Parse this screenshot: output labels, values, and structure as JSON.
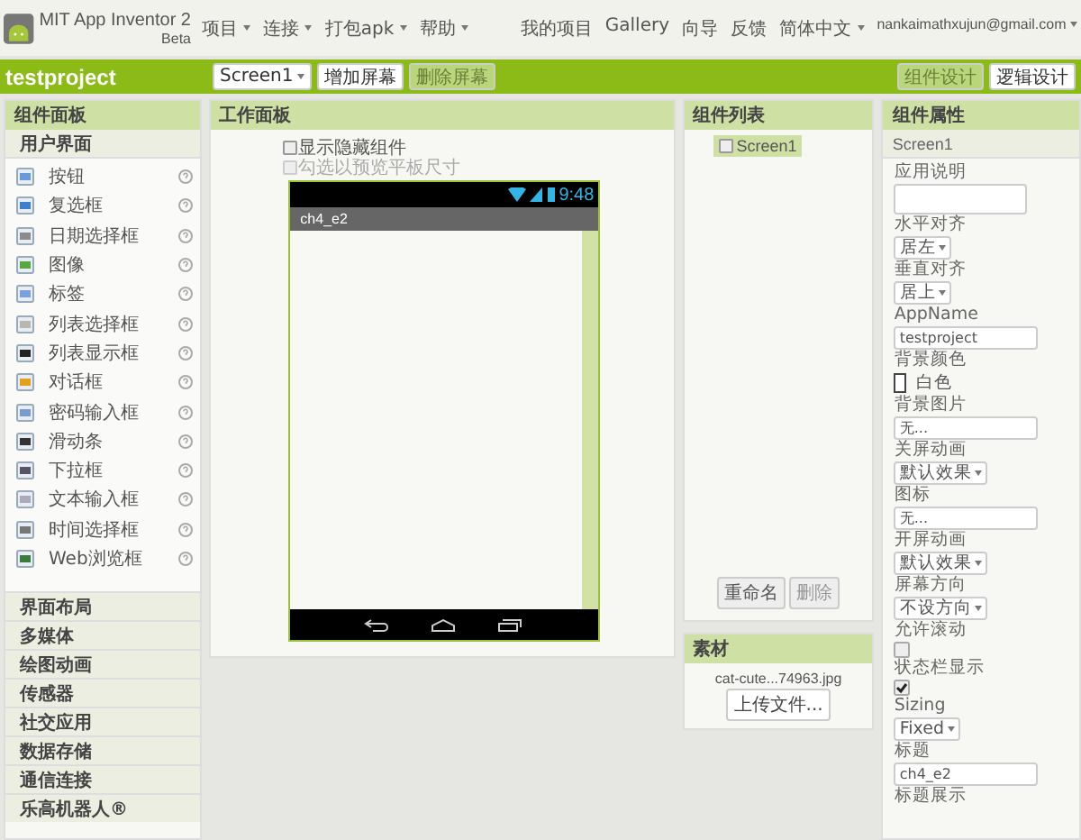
{
  "header": {
    "logo_title": "MIT App Inventor 2",
    "logo_subtitle": "Beta",
    "menus": [
      {
        "label": "项目",
        "dropdown": true
      },
      {
        "label": "连接",
        "dropdown": true
      },
      {
        "label": "打包apk",
        "dropdown": true
      },
      {
        "label": "帮助",
        "dropdown": true
      }
    ],
    "links": [
      {
        "label": "我的项目",
        "dropdown": false
      },
      {
        "label": "Gallery",
        "dropdown": false
      },
      {
        "label": "向导",
        "dropdown": false
      },
      {
        "label": "反馈",
        "dropdown": false
      },
      {
        "label": "简体中文",
        "dropdown": true
      },
      {
        "label": "nankaimathxujun@gmail.com",
        "dropdown": true
      }
    ]
  },
  "toolbar": {
    "project": "testproject",
    "screen_select": "Screen1",
    "buttons": [
      {
        "label": "增加屏幕",
        "disabled": false
      },
      {
        "label": "删除屏幕",
        "disabled": true
      }
    ],
    "modes": [
      {
        "label": "组件设计",
        "selected": true
      },
      {
        "label": "逻辑设计",
        "selected": false
      }
    ]
  },
  "palette": {
    "title": "组件面板",
    "open_category": "用户界面",
    "items": [
      {
        "label": "按钮"
      },
      {
        "label": "复选框"
      },
      {
        "label": "日期选择框"
      },
      {
        "label": "图像"
      },
      {
        "label": "标签"
      },
      {
        "label": "列表选择框"
      },
      {
        "label": "列表显示框"
      },
      {
        "label": "对话框"
      },
      {
        "label": "密码输入框"
      },
      {
        "label": "滑动条"
      },
      {
        "label": "下拉框"
      },
      {
        "label": "文本输入框"
      },
      {
        "label": "时间选择框"
      },
      {
        "label": "Web浏览框"
      }
    ],
    "categories": [
      "界面布局",
      "多媒体",
      "绘图动画",
      "传感器",
      "社交应用",
      "数据存储",
      "通信连接",
      "乐高机器人®"
    ]
  },
  "viewer": {
    "title": "工作面板",
    "options": [
      {
        "label": "显示隐藏组件",
        "checked": false,
        "disabled": false
      },
      {
        "label": "勾选以预览平板尺寸",
        "checked": false,
        "disabled": true
      }
    ],
    "phone": {
      "time": "9:48",
      "title": "ch4_e2"
    }
  },
  "components": {
    "title": "组件列表",
    "tree": [
      {
        "label": "Screen1",
        "selected": true
      }
    ],
    "buttons": [
      {
        "label": "重命名",
        "disabled": false
      },
      {
        "label": "删除",
        "disabled": true
      }
    ]
  },
  "media": {
    "title": "素材",
    "files": [
      "cat-cute...74963.jpg"
    ],
    "upload": "上传文件..."
  },
  "properties": {
    "title": "组件属性",
    "component": "Screen1",
    "items": [
      {
        "label": "应用说明",
        "kind": "textarea"
      },
      {
        "label": "水平对齐",
        "kind": "select",
        "value": "居左"
      },
      {
        "label": "垂直对齐",
        "kind": "select",
        "value": "居上"
      },
      {
        "label": "AppName",
        "kind": "text",
        "value": "testproject"
      },
      {
        "label": "背景颜色",
        "kind": "color",
        "value": "白色",
        "color": "#ffffff"
      },
      {
        "label": "背景图片",
        "kind": "text",
        "value": "无..."
      },
      {
        "label": "关屏动画",
        "kind": "select",
        "value": "默认效果"
      },
      {
        "label": "图标",
        "kind": "text",
        "value": "无..."
      },
      {
        "label": "开屏动画",
        "kind": "select",
        "value": "默认效果"
      },
      {
        "label": "屏幕方向",
        "kind": "select",
        "value": "不设方向"
      },
      {
        "label": "允许滚动",
        "kind": "checkbox",
        "checked": false
      },
      {
        "label": "状态栏显示",
        "kind": "checkbox",
        "checked": true
      },
      {
        "label": "Sizing",
        "kind": "select",
        "value": "Fixed"
      },
      {
        "label": "标题",
        "kind": "text",
        "value": "ch4_e2"
      },
      {
        "label": "标题展示",
        "kind": "label"
      }
    ]
  }
}
